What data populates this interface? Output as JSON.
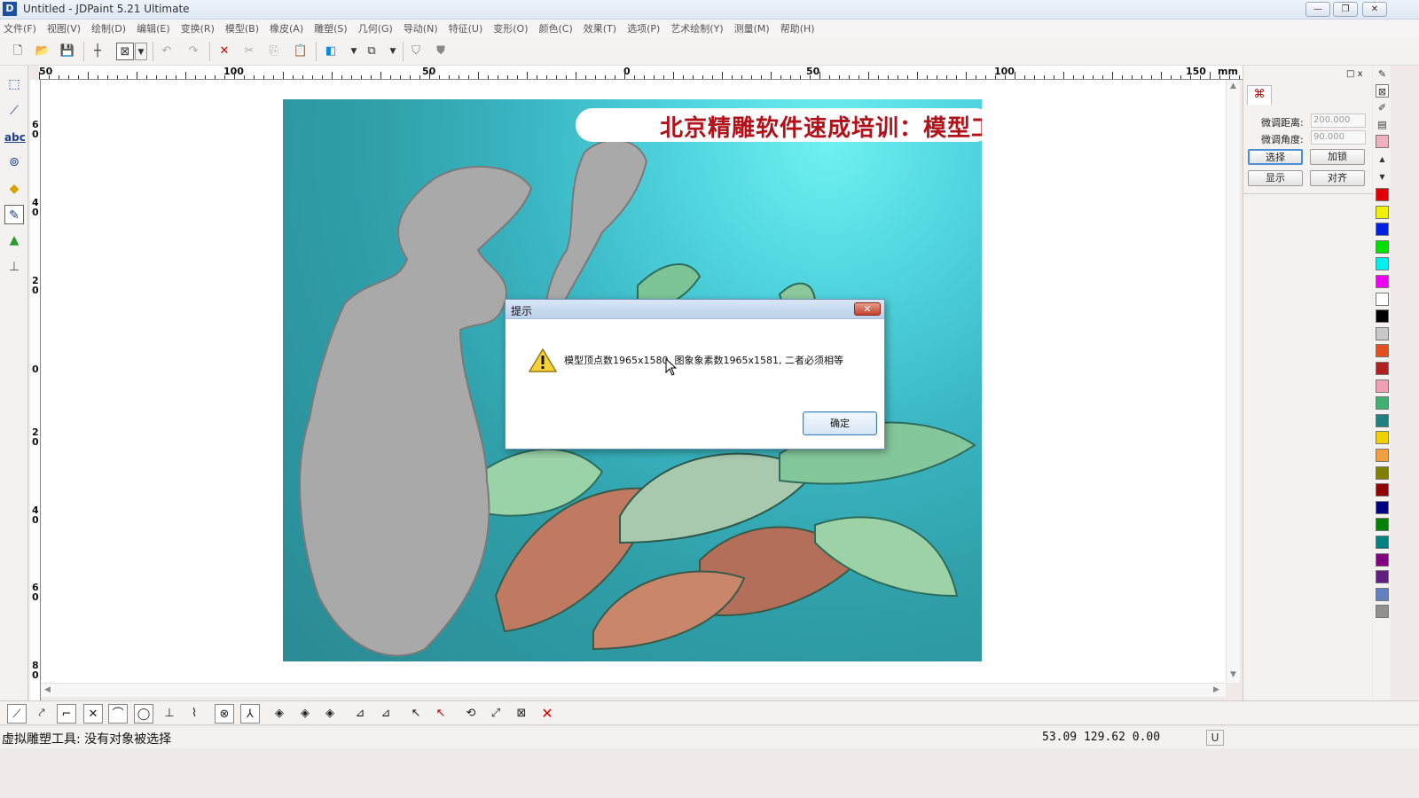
{
  "window": {
    "title": "Untitled - JDPaint 5.21 Ultimate",
    "minimize": "—",
    "restore": "❐",
    "close": "✕"
  },
  "menu": [
    "文件(F)",
    "视图(V)",
    "绘制(D)",
    "编辑(E)",
    "变换(R)",
    "模型(B)",
    "橡皮(A)",
    "雕塑(S)",
    "几何(G)",
    "导动(N)",
    "特征(U)",
    "变形(O)",
    "颜色(C)",
    "效果(T)",
    "选项(P)",
    "艺术绘制(Y)",
    "测量(M)",
    "帮助(H)"
  ],
  "ruler": {
    "labels": [
      "50",
      "100",
      "50",
      "0",
      "50",
      "100",
      "150"
    ],
    "unit": "mm",
    "vlabels": [
      "6\n0",
      "4\n0",
      "2\n0",
      "0",
      "2\n0",
      "4\n0",
      "6\n0",
      "8\n0"
    ]
  },
  "canvas": {
    "banner": "北京精雕软件速成培训：模型工具讲解"
  },
  "right_panel": {
    "tabs_close": "□ x",
    "fine_distance_label": "微调距离:",
    "fine_distance_value": "200.000",
    "fine_angle_label": "微调角度:",
    "fine_angle_value": "90.000",
    "btn_select": "选择",
    "btn_lock": "加锁",
    "btn_show": "显示",
    "btn_align": "对齐"
  },
  "colors": {
    "swatches": [
      "#e00000",
      "#f0f000",
      "#0020e0",
      "#00e000",
      "#00f0f0",
      "#f000f0",
      "#ffffff",
      "#000000",
      "#c8c8c8",
      "#e05020",
      "#b02020",
      "#f0a0b0",
      "#40b070",
      "#208080",
      "#f0d000",
      "#f0a040",
      "#808000",
      "#900000",
      "#000080",
      "#008000",
      "#008080",
      "#800080",
      "#602080",
      "#6080c0",
      "#909090"
    ]
  },
  "dialog": {
    "title": "提示",
    "message": "模型顶点数1965x1580, 图象象素数1965x1581, 二者必须相等",
    "ok": "确定",
    "close": "✕"
  },
  "status": {
    "message": "虚拟雕塑工具: 没有对象被选择",
    "coords": "53.09 129.62 0.00",
    "u": "U"
  }
}
